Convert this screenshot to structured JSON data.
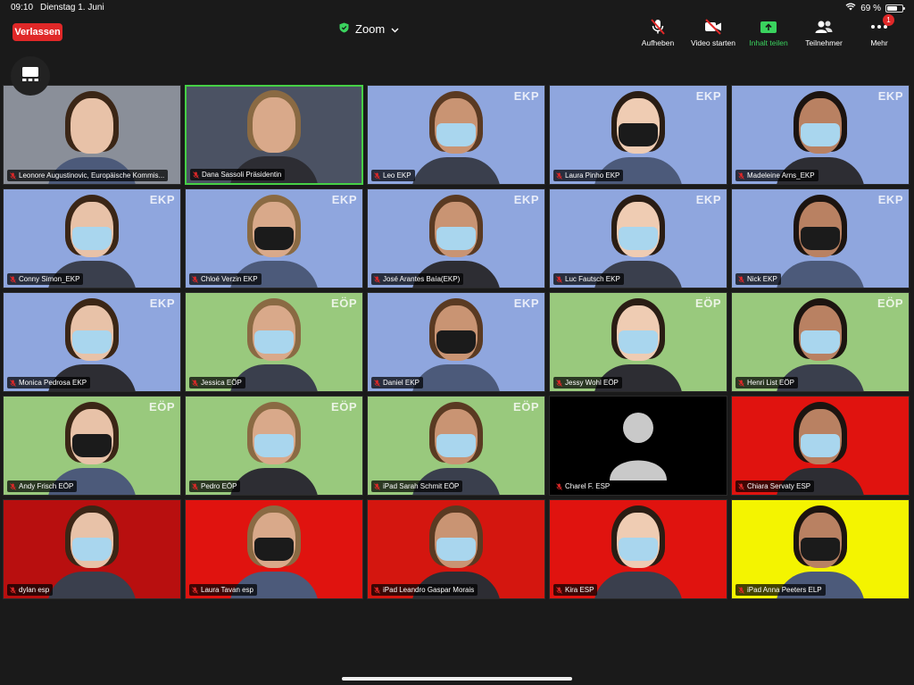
{
  "status_bar": {
    "time": "09:10",
    "date": "Dienstag 1. Juni",
    "battery_percent": "69 %",
    "battery_level": 0.69
  },
  "header": {
    "leave_label": "Verlassen",
    "meeting_title": "Zoom",
    "toolbar": [
      {
        "key": "unmute",
        "label": "Aufheben",
        "icon": "mic-off-icon"
      },
      {
        "key": "video",
        "label": "Video starten",
        "icon": "video-off-icon"
      },
      {
        "key": "share",
        "label": "Inhalt teilen",
        "icon": "share-screen-icon",
        "color": "#3ad35e"
      },
      {
        "key": "participants",
        "label": "Teilnehmer",
        "icon": "participants-icon"
      },
      {
        "key": "more",
        "label": "Mehr",
        "icon": "more-icon",
        "badge": "1"
      }
    ]
  },
  "colors": {
    "blue": "#8fa6de",
    "green": "#99c97d",
    "red": "#e0130f",
    "yellow": "#f4f400",
    "black": "#000000",
    "accent_active": "#46d046"
  },
  "participants": [
    {
      "name": "Leonore Augustinovic, Europäische Kommis...",
      "bg": "#8a8f99",
      "party": ""
    },
    {
      "name": "Dana Sassoli Präsidentin",
      "bg": "#4b5263",
      "party": "",
      "active": true
    },
    {
      "name": "Leo EKP",
      "bg": "#8fa6de",
      "party": "EKP"
    },
    {
      "name": "Laura Pinho EKP",
      "bg": "#8fa6de",
      "party": "EKP"
    },
    {
      "name": "Madeleine Arns_EKP",
      "bg": "#8fa6de",
      "party": "EKP"
    },
    {
      "name": "Conny Simon_EKP",
      "bg": "#8fa6de",
      "party": "EKP"
    },
    {
      "name": "Chloé Verzin EKP",
      "bg": "#8fa6de",
      "party": "EKP"
    },
    {
      "name": "José Arantes Baía(EKP)",
      "bg": "#8fa6de",
      "party": "EKP"
    },
    {
      "name": "Luc Fautsch EKP",
      "bg": "#8fa6de",
      "party": "EKP"
    },
    {
      "name": "Nick EKP",
      "bg": "#8fa6de",
      "party": "EKP"
    },
    {
      "name": "Monica Pedrosa EKP",
      "bg": "#8fa6de",
      "party": "EKP"
    },
    {
      "name": "Jessica EÖP",
      "bg": "#99c97d",
      "party": "EÖP"
    },
    {
      "name": "Daniel EKP",
      "bg": "#8fa6de",
      "party": "EKP"
    },
    {
      "name": "Jessy Wohl EÖP",
      "bg": "#99c97d",
      "party": "EÖP"
    },
    {
      "name": "Henri List EÖP",
      "bg": "#99c97d",
      "party": "EÖP"
    },
    {
      "name": "Andy Frisch EÖP",
      "bg": "#99c97d",
      "party": "EÖP"
    },
    {
      "name": "Pedro EÖP",
      "bg": "#99c97d",
      "party": "EÖP"
    },
    {
      "name": "iPad Sarah Schmit EÖP",
      "bg": "#99c97d",
      "party": "EÖP"
    },
    {
      "name": "Charel F. ESP",
      "bg": "#000000",
      "party": "",
      "no_video": true
    },
    {
      "name": "Chiara Servaty ESP",
      "bg": "#e0130f",
      "party": ""
    },
    {
      "name": "dylan esp",
      "bg": "#b80f0f",
      "party": ""
    },
    {
      "name": "Laura Tavan esp",
      "bg": "#e0130f",
      "party": ""
    },
    {
      "name": "iPad Leandro Gaspar Morais",
      "bg": "#d4160f",
      "party": ""
    },
    {
      "name": "Kira ESP",
      "bg": "#e0130f",
      "party": ""
    },
    {
      "name": "iPad Anna Peeters ELP",
      "bg": "#f4f400",
      "party": ""
    }
  ]
}
